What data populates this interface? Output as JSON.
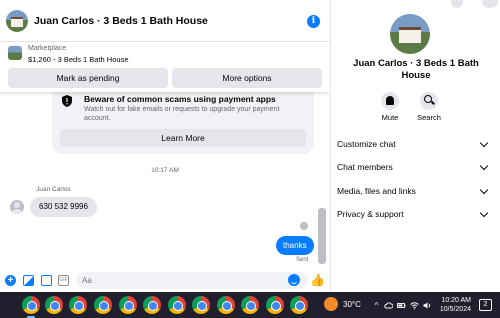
{
  "header": {
    "title": "Juan Carlos · 3 Beds 1 Bath House",
    "info_icon": "i"
  },
  "listing": {
    "category": "Marketplace",
    "title": "$1,260 - 3 Beds 1 Bath House",
    "mark_pending_label": "Mark as pending",
    "more_options_label": "More options"
  },
  "warning": {
    "title": "Beware of common scams using payment apps",
    "text": "Watch out for fake emails or requests to upgrade your payment account.",
    "learn_more_label": "Learn More"
  },
  "conversation": {
    "timestamp": "10:17 AM",
    "sender_name": "Juan Carlos",
    "incoming_message": "630 532 9996",
    "outgoing_message": "thanks",
    "status": "Sent"
  },
  "composer": {
    "placeholder": "Aa",
    "plus_glyph": "+",
    "gif_glyph": "GIF",
    "like_glyph": "👍"
  },
  "sidebar": {
    "name": "Juan Carlos · 3 Beds 1 Bath House",
    "actions": {
      "mute": "Mute",
      "search": "Search"
    },
    "menu": [
      {
        "label": "Customize chat"
      },
      {
        "label": "Chat members"
      },
      {
        "label": "Media, files and links"
      },
      {
        "label": "Privacy & support"
      }
    ]
  },
  "taskbar": {
    "weather": "30°C",
    "time": "10:20 AM",
    "date": "10/5/2024",
    "notification_count": "2",
    "tray_glyph_up": "^"
  },
  "colors": {
    "accent": "#0a7cff",
    "taskbar": "#1f1f2e",
    "bubble_in": "#e4e6eb"
  }
}
